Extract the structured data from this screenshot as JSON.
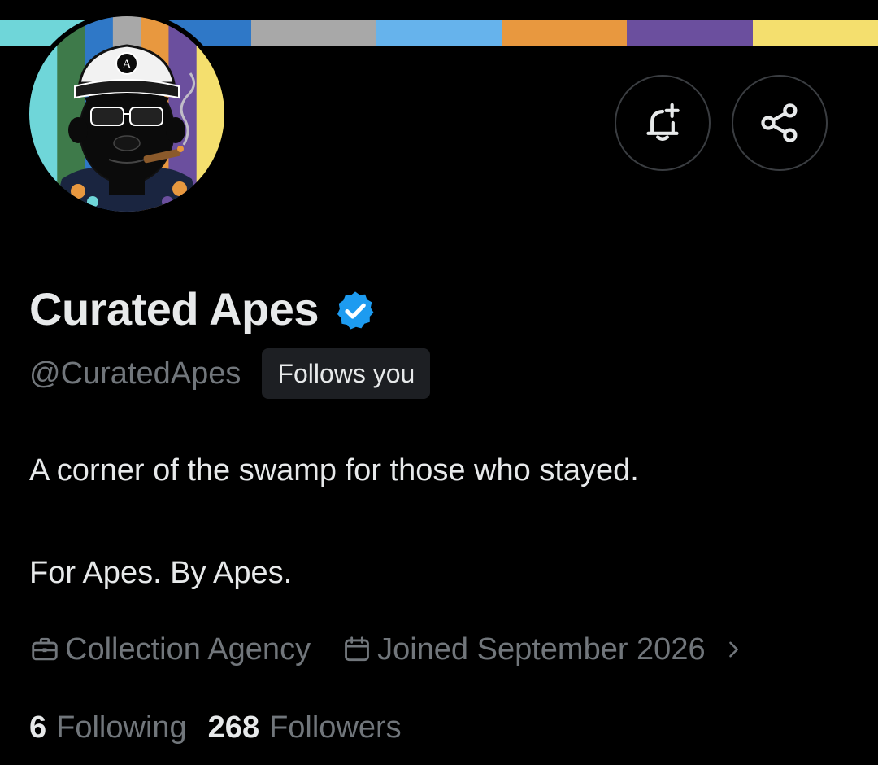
{
  "banner": {
    "stripe_colors": [
      "#6fd6d9",
      "#2f78c7",
      "#a8a8a8",
      "#66b3ec",
      "#e8983f",
      "#6b4f9e",
      "#f4df6e"
    ]
  },
  "avatar": {
    "alt": "Curated Apes avatar",
    "cap_badge_letter": "A",
    "stripe_colors": [
      "#6fd6d9",
      "#3e7a4a",
      "#2f78c7",
      "#a8a8a8",
      "#e8983f",
      "#6b4f9e",
      "#f4df6e"
    ]
  },
  "actions": {
    "notify_icon": "bell-plus-icon",
    "share_icon": "share-icon"
  },
  "profile": {
    "name": "Curated Apes",
    "handle": "@CuratedApes",
    "follows_badge": "Follows you",
    "bio_line1": "A corner of the swamp for those who stayed.",
    "bio_line2": "For Apes. By Apes.",
    "category": "Collection Agency",
    "joined": "Joined September 2026",
    "verified_color": "#1d9bf0"
  },
  "stats": {
    "following_count": "6",
    "following_label": "Following",
    "followers_count": "268",
    "followers_label": "Followers"
  }
}
